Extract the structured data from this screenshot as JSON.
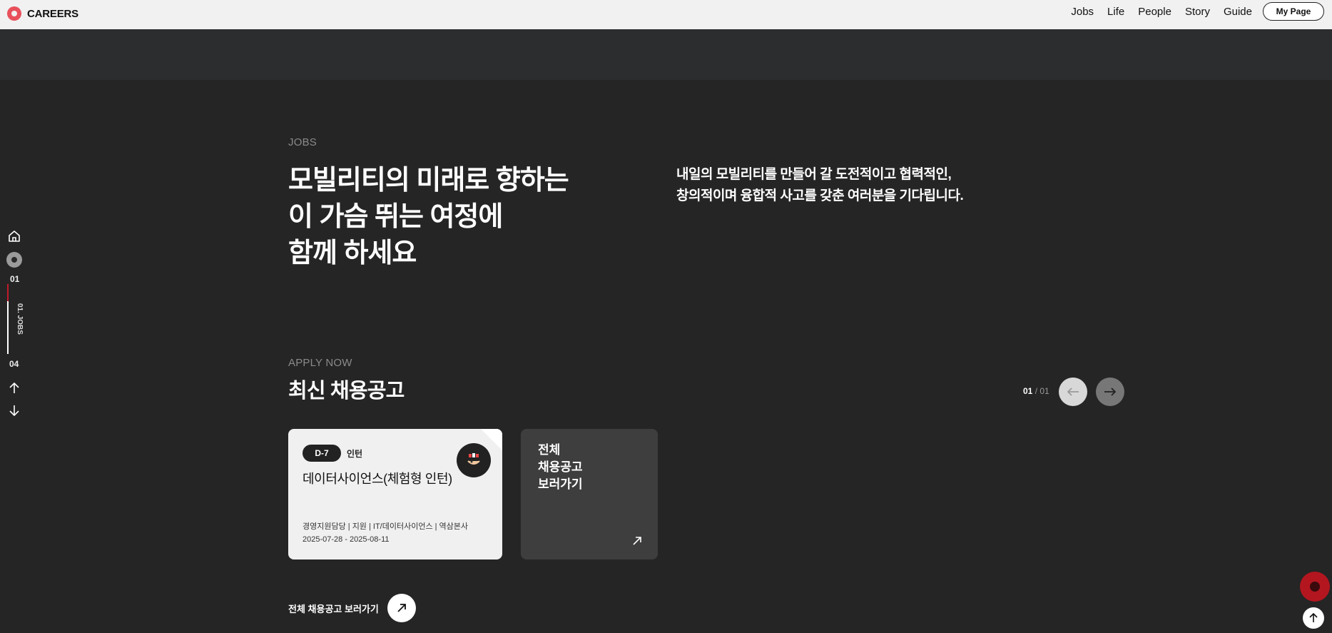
{
  "header": {
    "logo_text": "CAREERS",
    "nav": [
      "Jobs",
      "Life",
      "People",
      "Story",
      "Guide"
    ],
    "my_page": "My Page"
  },
  "side_nav": {
    "current": "01",
    "total": "04",
    "section_label": "01. JOBS"
  },
  "jobs_section": {
    "label": "JOBS",
    "headline": [
      "모빌리티의 미래로 향하는",
      "이 가슴 뛰는 여정에",
      "함께 하세요"
    ],
    "description": [
      "내일의 모빌리티를 만들어 갈 도전적이고 협력적인,",
      "창의적이며 융합적 사고를 갖춘 여러분을 기다립니다."
    ]
  },
  "apply_section": {
    "label": "APPLY NOW",
    "title": "최신 채용공고",
    "pager_current": "01",
    "pager_total": "/ 01"
  },
  "job_card": {
    "badge": "D-7",
    "type": "인턴",
    "title": "데이터사이언스(체험형 인턴)",
    "meta": "경영지원담당 | 지원 | IT/데이터사이언스 | 역삼본사",
    "date": "2025-07-28 - 2025-08-11"
  },
  "all_card": {
    "lines": [
      "전체",
      "채용공고",
      "보러가기"
    ]
  },
  "bottom_link": {
    "label": "전체 채용공고 보러가기"
  }
}
